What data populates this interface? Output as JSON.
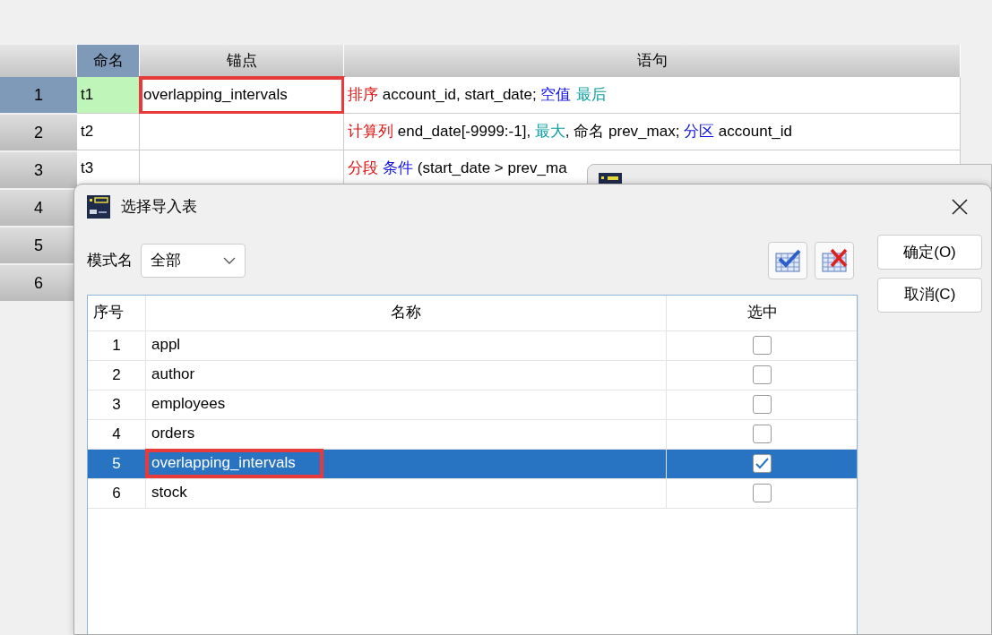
{
  "grid": {
    "columns": [
      "命名",
      "锚点",
      "语句"
    ],
    "row_numbers": [
      {
        "label": "1",
        "selected": true
      },
      {
        "label": "2",
        "selected": false
      },
      {
        "label": "3",
        "selected": false
      },
      {
        "label": "4",
        "selected": false
      },
      {
        "label": "5",
        "selected": false
      },
      {
        "label": "6",
        "selected": false
      }
    ],
    "rows": [
      {
        "name": "t1",
        "anchor": "overlapping_intervals",
        "anchor_highlighted": true,
        "selected": true,
        "statement": [
          {
            "kind": "command",
            "text": "排序"
          },
          {
            "kind": "plain",
            "text": " account_id, start_date; "
          },
          {
            "kind": "clause",
            "text": "空值"
          },
          {
            "kind": "option",
            "text": "最后",
            "space_before": true
          }
        ]
      },
      {
        "name": "t2",
        "anchor_highlighted": false,
        "selected": false,
        "statement": [
          {
            "kind": "command",
            "text": "计算列"
          },
          {
            "kind": "plain",
            "text": " end_date[-9999:-1], "
          },
          {
            "kind": "option",
            "text": "最大"
          },
          {
            "kind": "plain",
            "text": ", 命名 prev_max; "
          },
          {
            "kind": "clause",
            "text": "分区"
          },
          {
            "kind": "plain",
            "text": " account_id"
          }
        ]
      },
      {
        "name": "t3",
        "anchor_highlighted": false,
        "selected": false,
        "statement": [
          {
            "kind": "command",
            "text": "分段"
          },
          {
            "kind": "clause",
            "text": "条件",
            "space_before": true
          },
          {
            "kind": "plain",
            "text": " (start_date > prev_ma"
          }
        ]
      }
    ]
  },
  "dialog": {
    "title": "选择导入表",
    "schema_label": "模式名",
    "schema_value": "全部",
    "buttons": [
      "确定(O)",
      "取消(C)"
    ],
    "table": {
      "columns": [
        "序号",
        "名称",
        "选中"
      ],
      "rows": [
        {
          "index": "1",
          "name": "appl",
          "checked": false,
          "selected": false,
          "highlighted": false
        },
        {
          "index": "2",
          "name": "author",
          "checked": false,
          "selected": false,
          "highlighted": false
        },
        {
          "index": "3",
          "name": "employees",
          "checked": false,
          "selected": false,
          "highlighted": false
        },
        {
          "index": "4",
          "name": "orders",
          "checked": false,
          "selected": false,
          "highlighted": false
        },
        {
          "index": "5",
          "name": "overlapping_intervals",
          "checked": true,
          "selected": true,
          "highlighted": true
        },
        {
          "index": "6",
          "name": "stock",
          "checked": false,
          "selected": false,
          "highlighted": false
        }
      ]
    }
  }
}
